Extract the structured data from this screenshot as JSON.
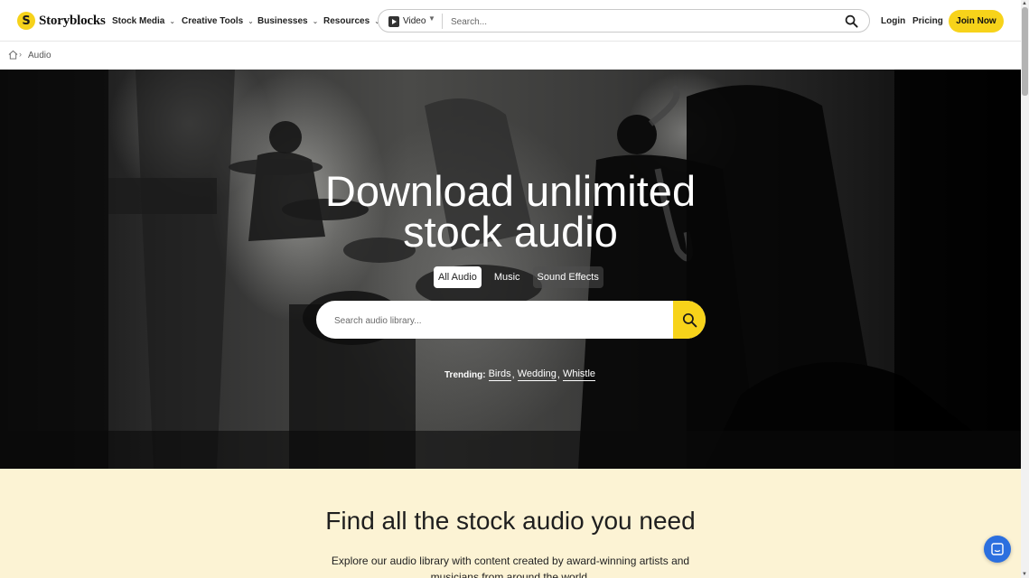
{
  "brand": {
    "name": "Storyblocks",
    "logo_glyph": "S"
  },
  "nav": {
    "menus": [
      {
        "label": "Stock Media"
      },
      {
        "label": "Creative Tools"
      },
      {
        "label": "Businesses"
      },
      {
        "label": "Resources"
      }
    ],
    "search": {
      "type_label": "Video",
      "placeholder": "Search..."
    },
    "login": "Login",
    "pricing": "Pricing",
    "join": "Join Now"
  },
  "breadcrumb": {
    "current": "Audio"
  },
  "hero": {
    "title_line1": "Download unlimited",
    "title_line2": "stock audio",
    "tabs": [
      "All Audio",
      "Music",
      "Sound Effects"
    ],
    "active_tab": "All Audio",
    "search_placeholder": "Search audio library...",
    "trending_label": "Trending:",
    "trending": [
      "Birds",
      "Wedding",
      "Whistle"
    ]
  },
  "lower": {
    "heading": "Find all the stock audio you need",
    "subtext": "Explore our audio library with content created by award-winning artists and musicians from around the world."
  },
  "colors": {
    "brand_yellow": "#f7d31a",
    "cream_bg": "#fcf3d4",
    "chat_blue": "#2b6fdf"
  },
  "icons": {
    "search": "search-icon",
    "home": "home-icon",
    "chevron": "chevron-down-icon",
    "video_type": "play-icon",
    "chat": "chat-icon"
  }
}
